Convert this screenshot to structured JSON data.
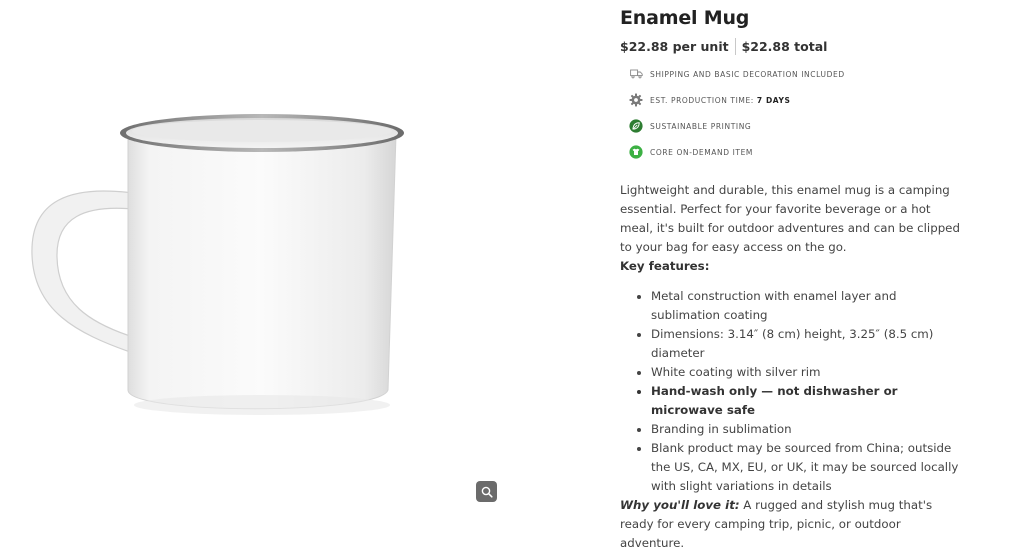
{
  "product": {
    "title": "Enamel Mug",
    "price_per_unit": "$22.88 per unit",
    "price_total": "$22.88 total",
    "image_alt": "White enamel mug with silver rim",
    "features": [
      {
        "icon": "truck-icon",
        "label": "Shipping and basic decoration included",
        "value": ""
      },
      {
        "icon": "gear-icon",
        "label": "Est. production time:",
        "value": "7 days"
      },
      {
        "icon": "leaf-icon",
        "label": "Sustainable printing",
        "value": ""
      },
      {
        "icon": "shirt-icon",
        "label": "Core on-demand item",
        "value": ""
      }
    ],
    "description": "Lightweight and durable, this enamel mug is a camping essential. Perfect for your favorite beverage or a hot meal, it's built for outdoor adventures and can be clipped to your bag for easy access on the go.",
    "key_features_heading": "Key features:",
    "key_features": [
      "Metal construction with enamel layer and sublimation coating",
      "Dimensions: 3.14″ (8 cm) height, 3.25″ (8.5 cm) diameter",
      "White coating with silver rim",
      "Hand-wash only — not dishwasher or microwave safe",
      "Branding in sublimation",
      "Blank product may be sourced from China; outside the US, CA, MX, EU, or UK, it may be sourced locally with slight variations in details"
    ],
    "why_love_label": "Why you'll love it:",
    "why_love_text": " A rugged and stylish mug that's ready for every camping trip, picnic, or outdoor adventure."
  },
  "colors": {
    "leaf_green": "#2e7d32",
    "core_green": "#3cb043",
    "zoom_button": "#6b6b6b"
  }
}
